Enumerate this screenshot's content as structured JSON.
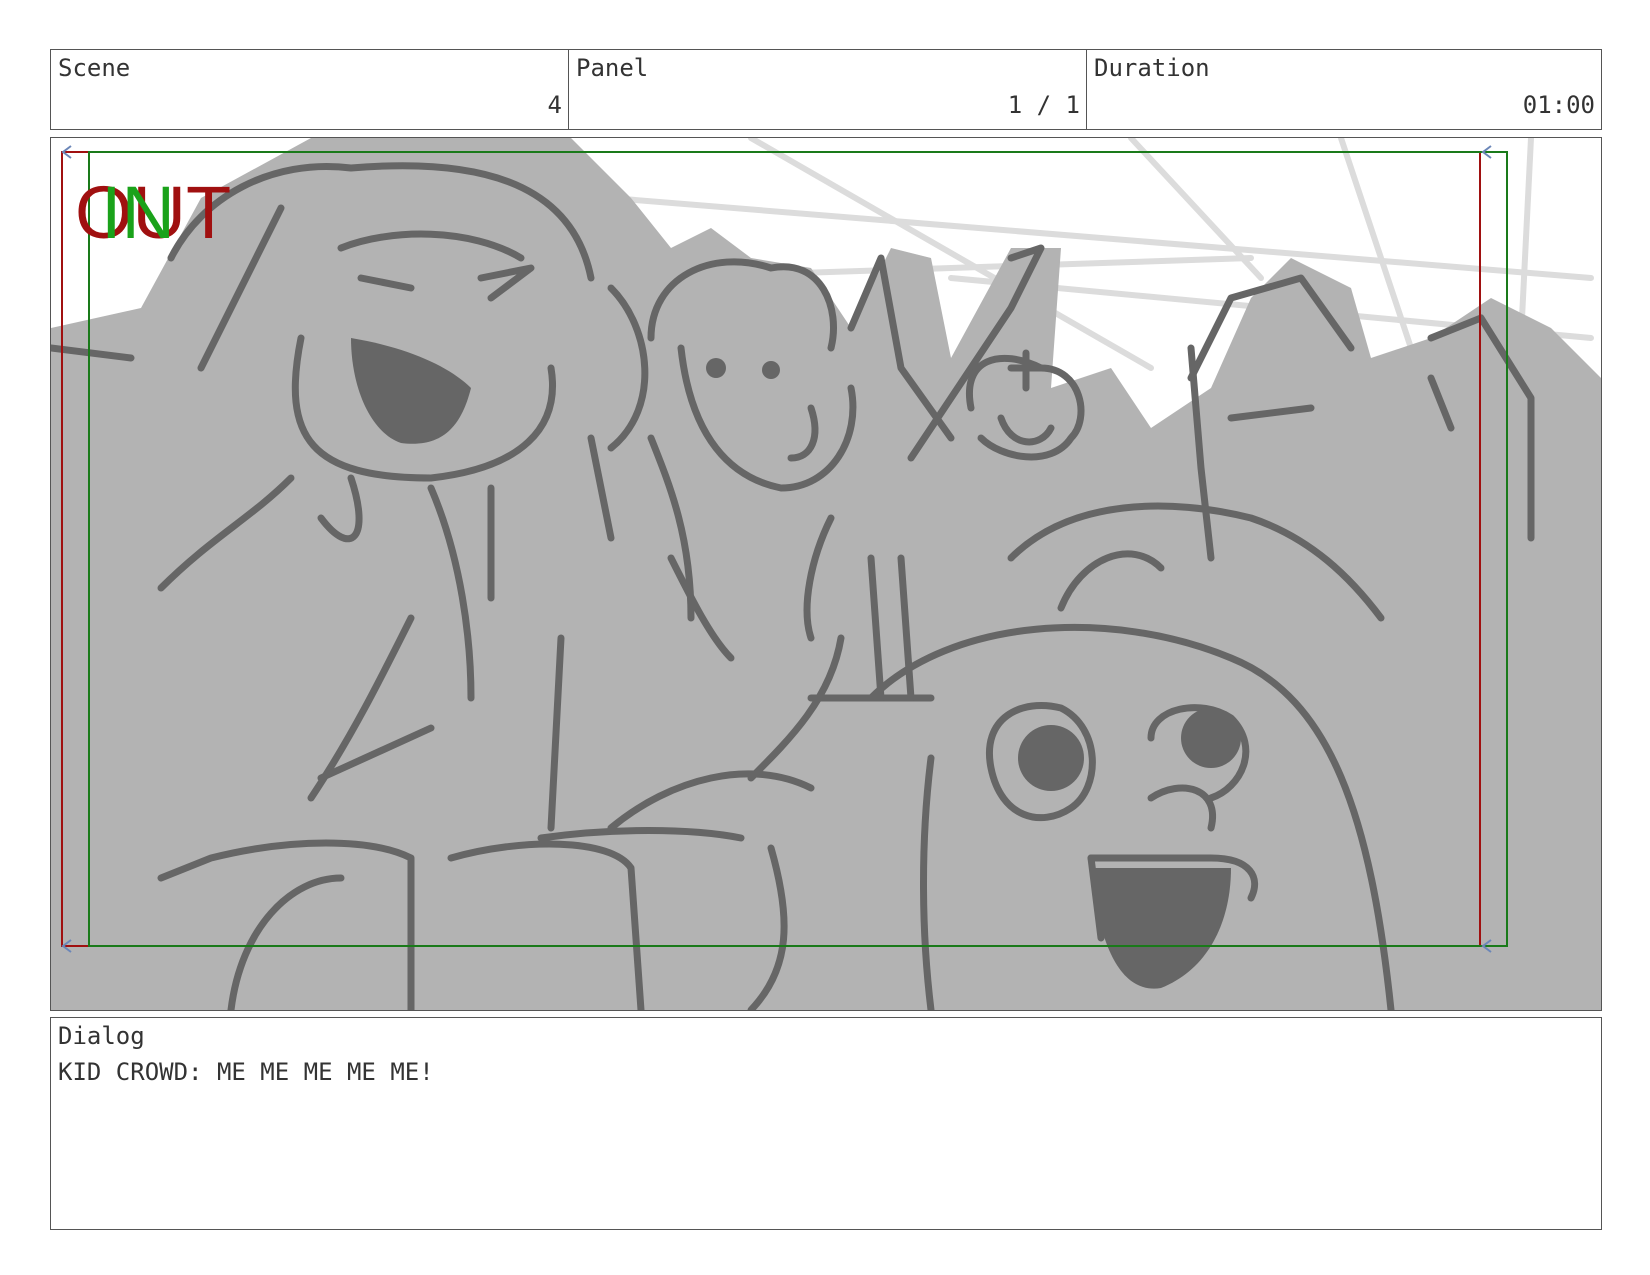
{
  "header": {
    "scene_label": "Scene",
    "scene_value": "4",
    "panel_label": "Panel",
    "panel_value": "1 / 1",
    "duration_label": "Duration",
    "duration_value": "01:00"
  },
  "panel": {
    "out_mark": "OUT",
    "in_mark": "IN",
    "out_frame_color": "#a01010",
    "in_frame_color": "#1a7a1a",
    "fill_color": "#b3b3b3",
    "line_color": "#666666"
  },
  "dialog": {
    "label": "Dialog",
    "text": "KID CROWD: ME ME ME ME ME!"
  }
}
